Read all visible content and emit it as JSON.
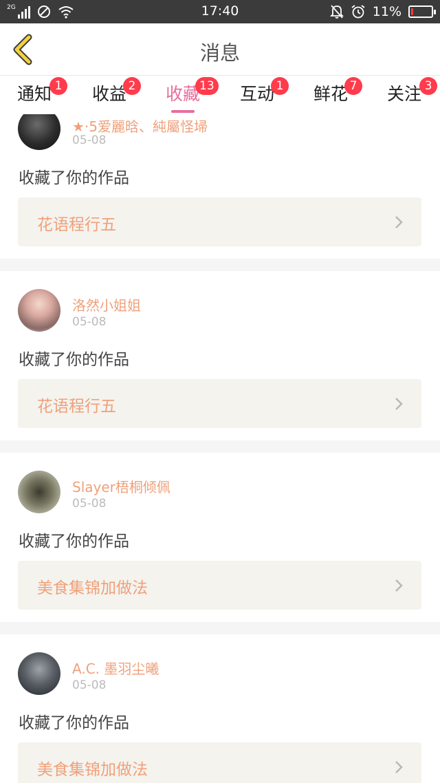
{
  "status_bar": {
    "network": "2G",
    "time": "17:40",
    "battery_percent": "11%",
    "battery_level": 0.11,
    "icons": [
      "signal-icon",
      "blocked-icon",
      "wifi-icon",
      "bell-off-icon",
      "alarm-icon",
      "battery-icon"
    ]
  },
  "header": {
    "title": "消息",
    "back_icon": "chevron-left-icon"
  },
  "tabs": [
    {
      "label": "通知",
      "badge": "1",
      "active": false
    },
    {
      "label": "收益",
      "badge": "2",
      "active": false
    },
    {
      "label": "收藏",
      "badge": "13",
      "active": true
    },
    {
      "label": "互动",
      "badge": "1",
      "active": false
    },
    {
      "label": "鲜花",
      "badge": "7",
      "active": false
    },
    {
      "label": "关注",
      "badge": "3",
      "active": false
    }
  ],
  "cards": [
    {
      "username": "★·5爱麗晗、純屬怪埽",
      "date": "05-08",
      "action": "收藏了你的作品",
      "work_title": "花语程行五"
    },
    {
      "username": "洛然小姐姐",
      "date": "05-08",
      "action": "收藏了你的作品",
      "work_title": "花语程行五"
    },
    {
      "username": "Slayer梧桐倾佩",
      "date": "05-08",
      "action": "收藏了你的作品",
      "work_title": "美食集锦加做法"
    },
    {
      "username": "A.C. 墨羽尘曦",
      "date": "05-08",
      "action": "收藏了你的作品",
      "work_title": "美食集锦加做法"
    }
  ],
  "colors": {
    "accent_pink": "#e96c9c",
    "badge_red": "#ff3b4c",
    "username_orange": "#f0a07a",
    "work_box_bg": "#f4f3ee",
    "back_arrow_yellow": "#f3d23a"
  }
}
